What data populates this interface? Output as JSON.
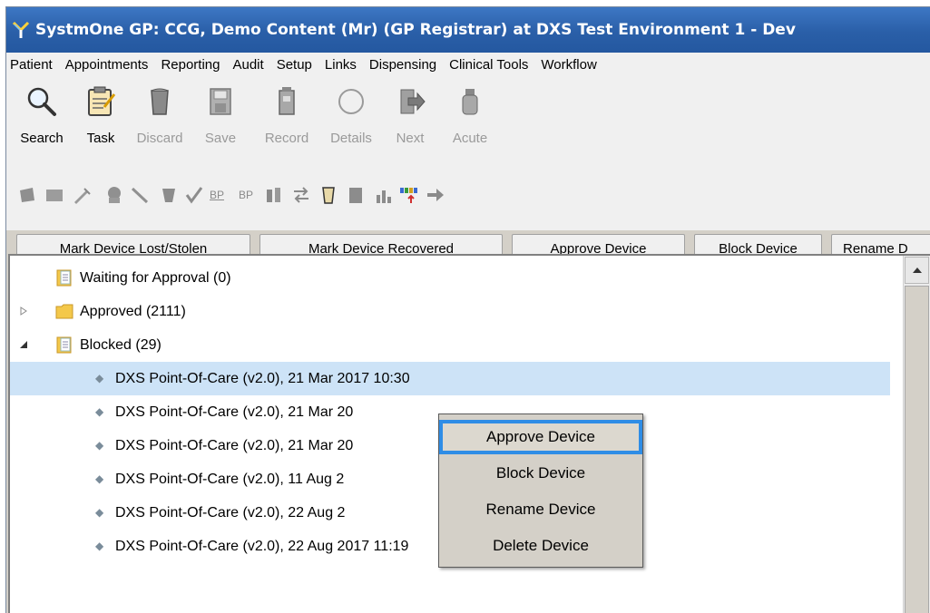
{
  "window": {
    "title": "SystmOne GP: CCG, Demo Content (Mr) (GP Registrar) at DXS Test Environment 1 - Dev"
  },
  "menu": [
    "Patient",
    "Appointments",
    "Reporting",
    "Audit",
    "Setup",
    "Links",
    "Dispensing",
    "Clinical Tools",
    "Workflow"
  ],
  "toolbar": {
    "buttons": [
      {
        "label": "Search",
        "icon": "magnifier-icon",
        "enabled": true
      },
      {
        "label": "Task",
        "icon": "clipboard-icon",
        "enabled": true
      },
      {
        "label": "Discard",
        "icon": "bin-icon",
        "enabled": false
      },
      {
        "label": "Save",
        "icon": "floppy-icon",
        "enabled": false
      },
      {
        "label": "Record",
        "icon": "record-icon",
        "enabled": false
      },
      {
        "label": "Details",
        "icon": "circle-icon",
        "enabled": false
      },
      {
        "label": "Next",
        "icon": "next-arrow-icon",
        "enabled": false
      },
      {
        "label": "Acute",
        "icon": "bottle-icon",
        "enabled": false
      }
    ],
    "icon_row_text": {
      "bp_underlined": "BP",
      "bp": "BP"
    }
  },
  "actions": [
    "Mark Device Lost/Stolen",
    "Mark Device Recovered",
    "Approve Device",
    "Block Device",
    "Rename D"
  ],
  "tree": {
    "groups": [
      {
        "label": "Waiting for Approval (0)",
        "expander": "none"
      },
      {
        "label": "Approved (2111)",
        "expander": "collapsed"
      },
      {
        "label": "Blocked (29)",
        "expander": "expanded"
      }
    ],
    "devices": [
      "DXS Point-Of-Care (v2.0), 21 Mar 2017 10:30",
      "DXS Point-Of-Care (v2.0), 21 Mar 20",
      "DXS Point-Of-Care (v2.0), 21 Mar 20",
      "DXS Point-Of-Care (v2.0), 11 Aug 2",
      "DXS Point-Of-Care (v2.0), 22 Aug 2",
      "DXS Point-Of-Care (v2.0), 22 Aug 2017 11:19"
    ]
  },
  "context_menu": {
    "items": [
      "Approve Device",
      "Block Device",
      "Rename Device",
      "Delete Device"
    ],
    "highlighted": "Approve Device",
    "highlight_color": "#2f8de6"
  },
  "colors": {
    "titlebar": "#2a5fa8",
    "selected_row": "#cde3f7"
  }
}
